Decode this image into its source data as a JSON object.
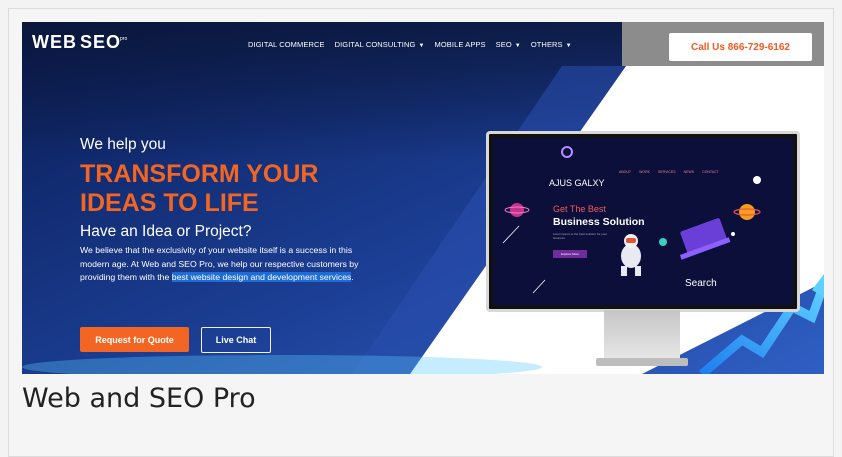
{
  "brand": {
    "logo_text": "WEB SEO"
  },
  "nav": {
    "items": [
      {
        "label": "DIGITAL COMMERCE",
        "caret": false
      },
      {
        "label": "DIGITAL CONSULTING",
        "caret": true
      },
      {
        "label": "MOBILE APPS",
        "caret": false
      },
      {
        "label": "SEO",
        "caret": true
      },
      {
        "label": "OTHERS",
        "caret": true
      }
    ],
    "caret_glyph": "▼",
    "call_button": "Call Us 866-729-6162"
  },
  "hero": {
    "kicker": "We help you",
    "headline_line1": "TRANSFORM YOUR",
    "headline_line2": "IDEAS TO LIFE",
    "subheading": "Have an Idea or Project?",
    "body_prefix": "We believe that the exclusivity of your website itself is a success in this modern age. At Web and SEO Pro, we help our respective customers by providing them with the ",
    "body_highlight": "best website design and development services",
    "body_suffix": ".",
    "quote_button": "Request for Quote",
    "chat_button": "Live Chat"
  },
  "monitor_screen": {
    "site_name": "AJUS GALXY",
    "nav": [
      "ABOUT",
      "WORK",
      "SERVICES",
      "NEWS",
      "CONTACT"
    ],
    "tagline_small": "Get The Best",
    "tagline_big": "Business Solution",
    "body": "Lorem ipsum is the best solution for your business",
    "button": "Explore More",
    "search_label": "Search"
  },
  "caption": "Web and SEO Pro",
  "colors": {
    "accent": "#f26522",
    "hero_blue": "#0e2a6a",
    "highlight": "#1e6cd6"
  }
}
